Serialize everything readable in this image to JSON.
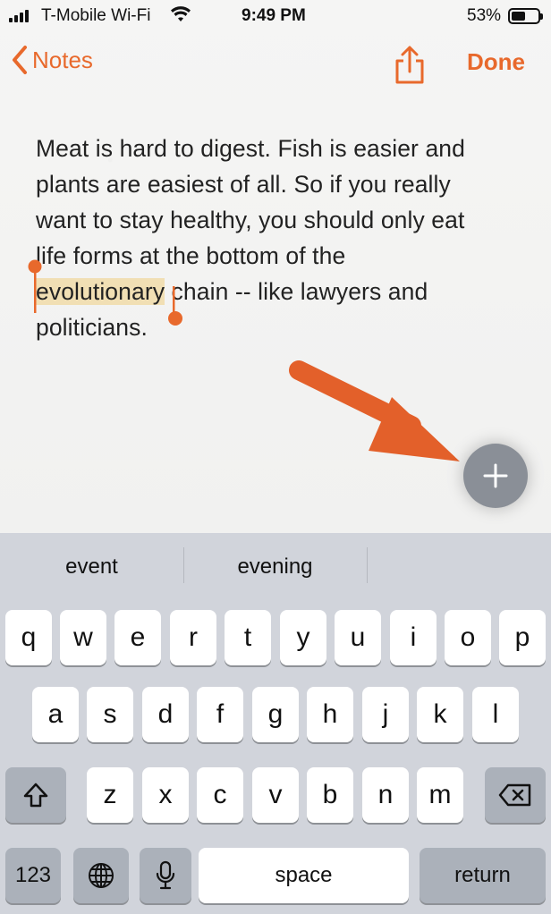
{
  "status_bar": {
    "carrier": "T-Mobile Wi-Fi",
    "time": "9:49 PM",
    "battery_percent": "53%",
    "battery_level": 0.53
  },
  "nav": {
    "back_label": "Notes",
    "done_label": "Done"
  },
  "note": {
    "line1": "Meat is hard to digest. Fish is easier and",
    "line2": "plants are easiest of all. So if you really",
    "line3": "want to stay healthy, you should only eat",
    "line4": "life forms at the bottom of the",
    "selected_word": "evolutionary",
    "line5_rest": " chain -- like lawyers and",
    "line6": "politicians."
  },
  "suggestions": [
    "event",
    "evening",
    ""
  ],
  "keyboard": {
    "row1": [
      "q",
      "w",
      "e",
      "r",
      "t",
      "y",
      "u",
      "i",
      "o",
      "p"
    ],
    "row2": [
      "a",
      "s",
      "d",
      "f",
      "g",
      "h",
      "j",
      "k",
      "l"
    ],
    "row3": [
      "z",
      "x",
      "c",
      "v",
      "b",
      "n",
      "m"
    ],
    "numbers_label": "123",
    "space_label": "space",
    "return_label": "return"
  },
  "colors": {
    "accent": "#e8692c",
    "highlight": "#f1dfb4",
    "keyboard_bg": "#d1d4db"
  },
  "icons": {
    "share": "share-icon",
    "back": "chevron-left-icon",
    "add": "plus-icon",
    "shift": "shift-icon",
    "delete": "delete-icon",
    "globe": "globe-icon",
    "mic": "microphone-icon"
  }
}
